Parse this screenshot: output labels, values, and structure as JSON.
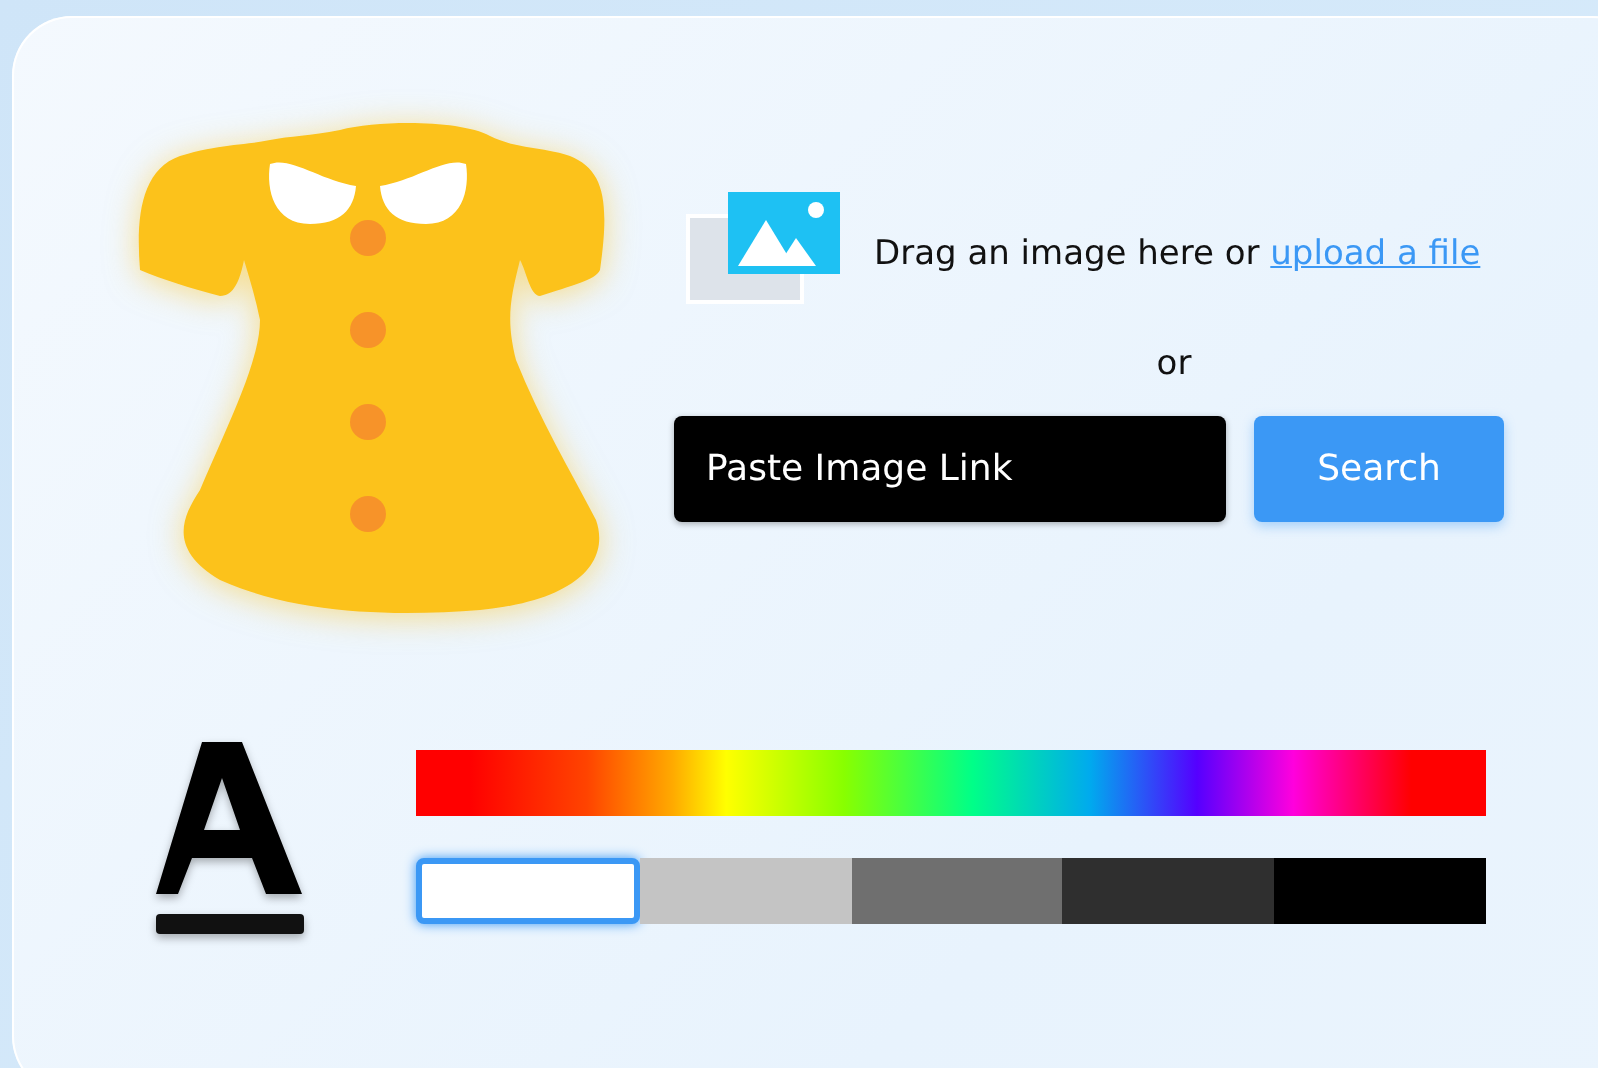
{
  "upload": {
    "prompt": "Drag an image here or",
    "link": "upload a file"
  },
  "separator": "or",
  "link_field": {
    "placeholder": "Paste Image Link"
  },
  "search_button": "Search",
  "swatches": [
    {
      "color": "#ffffff",
      "selected": true
    },
    {
      "color": "#c4c4c4",
      "selected": false
    },
    {
      "color": "#6f6f6f",
      "selected": false
    },
    {
      "color": "#2f2f2f",
      "selected": false
    },
    {
      "color": "#000000",
      "selected": false
    }
  ]
}
